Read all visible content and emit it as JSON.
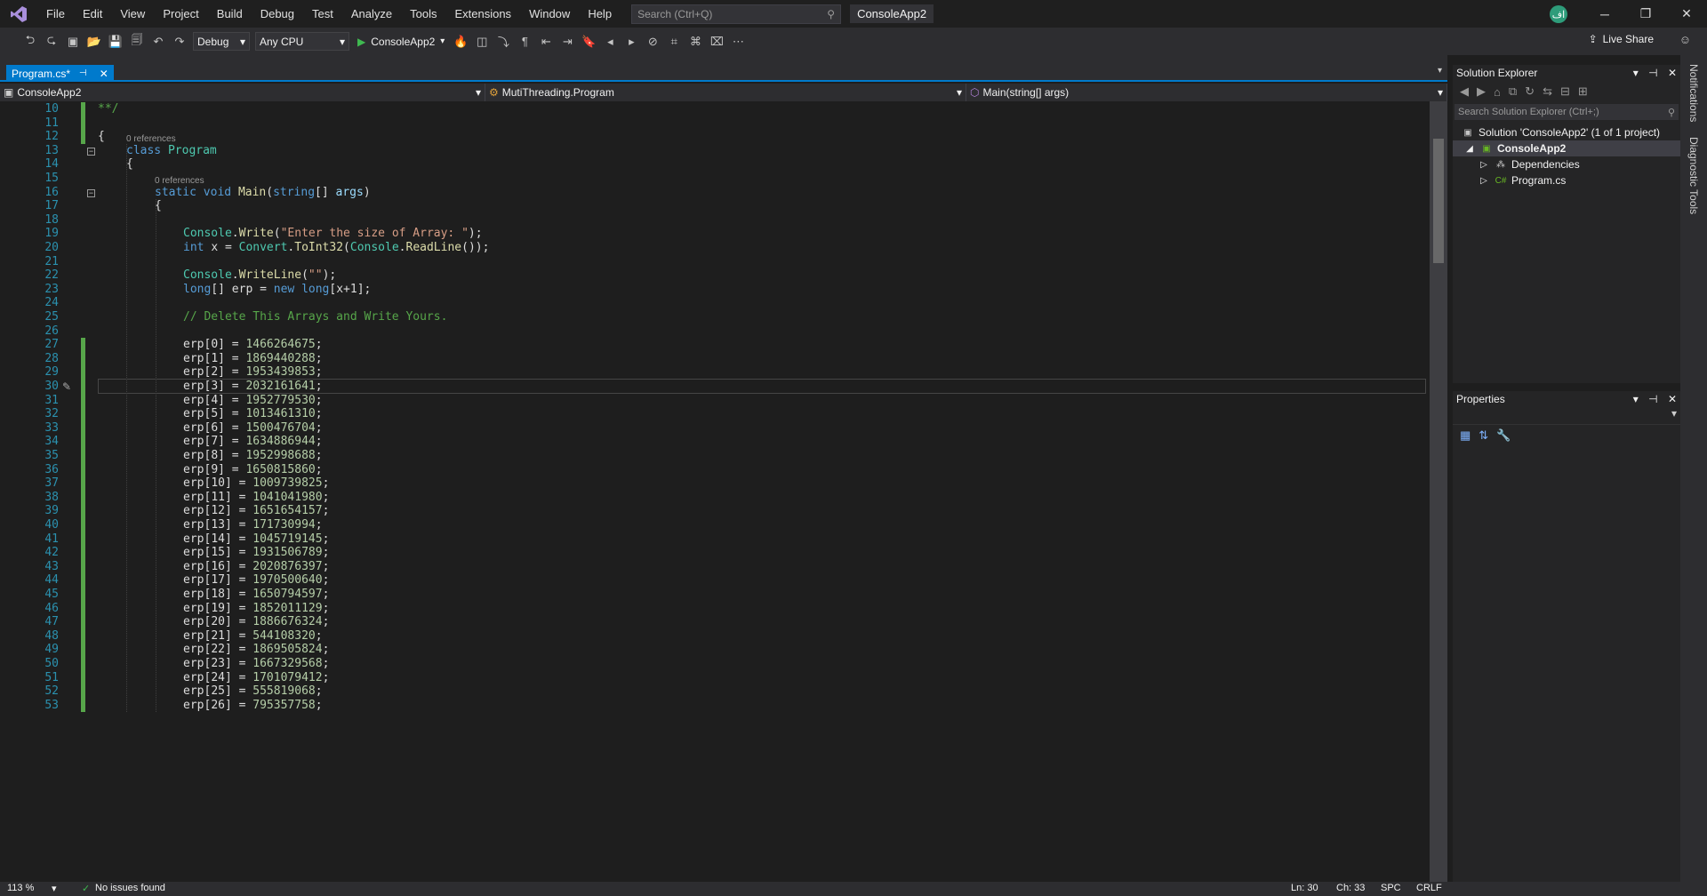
{
  "menu": {
    "items": [
      "File",
      "Edit",
      "View",
      "Project",
      "Build",
      "Debug",
      "Test",
      "Analyze",
      "Tools",
      "Extensions",
      "Window",
      "Help"
    ],
    "search_placeholder": "Search (Ctrl+Q)",
    "solution_name": "ConsoleApp2",
    "avatar_initials": "اف"
  },
  "toolbar": {
    "config": "Debug",
    "platform": "Any CPU",
    "start_target": "ConsoleApp2",
    "live_share": "Live Share"
  },
  "tab": {
    "label": "Program.cs*",
    "pin_glyph": "⊣",
    "close_glyph": "✕"
  },
  "navbar": {
    "project": "ConsoleApp2",
    "type": "MutiThreading.Program",
    "member": "Main(string[] args)"
  },
  "editor": {
    "references_label": "0 references",
    "line_numbers": [
      "10",
      "11",
      "12",
      "13",
      "14",
      "15",
      "16",
      "17",
      "18",
      "19",
      "20",
      "21",
      "22",
      "23",
      "24",
      "25",
      "26",
      "27",
      "28",
      "29",
      "30",
      "31",
      "32",
      "33",
      "34",
      "35",
      "36",
      "37",
      "38",
      "39",
      "40",
      "41",
      "42",
      "43",
      "44",
      "45",
      "46",
      "47",
      "48",
      "49",
      "50",
      "51",
      "52",
      "53"
    ],
    "top_comment": "**/",
    "class_line": [
      "class",
      "Program"
    ],
    "main_sig": [
      "static",
      "void",
      "Main",
      "string",
      "args"
    ],
    "write_line": [
      "Console",
      ".",
      "Write",
      "\"Enter the size of Array: \"",
      ");"
    ],
    "int_line": [
      "int",
      "x = ",
      "Convert",
      ".",
      "ToInt32",
      "(",
      "Console",
      ".",
      "ReadLine",
      "());"
    ],
    "writeline_line": [
      "Console",
      ".",
      "WriteLine",
      "\"\"",
      ");"
    ],
    "long_line": [
      "long",
      "[] erp = ",
      "new",
      "long",
      "[x+1];"
    ],
    "comment_line": "// Delete This Arrays and Write Yours.",
    "erp_values": [
      "1466264675",
      "1869440288",
      "1953439853",
      "2032161641",
      "1952779530",
      "1013461310",
      "1500476704",
      "1634886944",
      "1952998688",
      "1650815860",
      "1009739825",
      "1041041980",
      "1651654157",
      "171730994",
      "1045719145",
      "1931506789",
      "2020876397",
      "1970500640",
      "1650794597",
      "1852011129",
      "1886676324",
      "544108320",
      "1869505824",
      "1667329568",
      "1701079412",
      "555819068",
      "795357758"
    ]
  },
  "solution_explorer": {
    "title": "Solution Explorer",
    "search_placeholder": "Search Solution Explorer (Ctrl+;)",
    "tree": [
      "Solution 'ConsoleApp2' (1 of 1 project)",
      "ConsoleApp2",
      "Dependencies",
      "Program.cs"
    ]
  },
  "properties": {
    "title": "Properties"
  },
  "rail": {
    "notifications": "Notifications",
    "diagnostic": "Diagnostic Tools"
  },
  "status": {
    "zoom": "113 %",
    "issues": "No issues found",
    "ln": "Ln: 30",
    "ch": "Ch: 33",
    "spc": "SPC",
    "crlf": "CRLF"
  }
}
